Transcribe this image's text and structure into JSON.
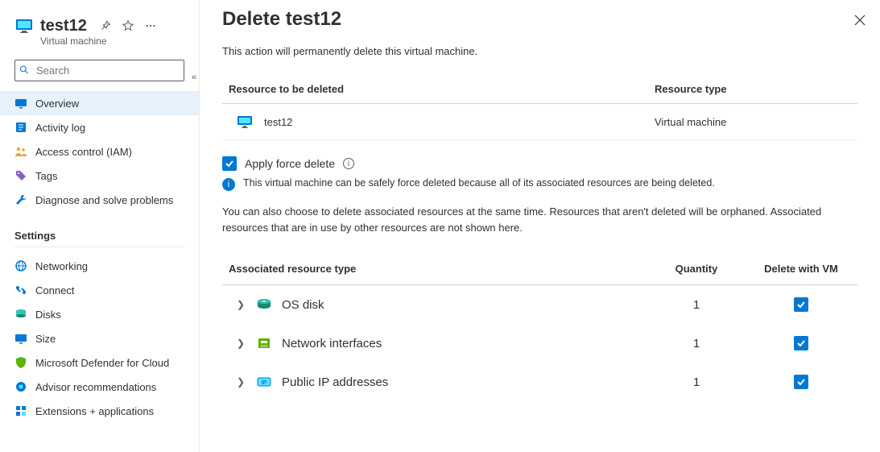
{
  "sidebar": {
    "title": "test12",
    "subtitle": "Virtual machine",
    "search_placeholder": "Search",
    "nav_main": [
      {
        "label": "Overview",
        "icon": "vm",
        "selected": true
      },
      {
        "label": "Activity log",
        "icon": "log",
        "selected": false
      },
      {
        "label": "Access control (IAM)",
        "icon": "people",
        "selected": false
      },
      {
        "label": "Tags",
        "icon": "tag",
        "selected": false
      },
      {
        "label": "Diagnose and solve problems",
        "icon": "wrench",
        "selected": false
      }
    ],
    "section_settings_label": "Settings",
    "nav_settings": [
      {
        "label": "Networking",
        "icon": "network"
      },
      {
        "label": "Connect",
        "icon": "connect"
      },
      {
        "label": "Disks",
        "icon": "disks"
      },
      {
        "label": "Size",
        "icon": "size"
      },
      {
        "label": "Microsoft Defender for Cloud",
        "icon": "shield"
      },
      {
        "label": "Advisor recommendations",
        "icon": "advisor"
      },
      {
        "label": "Extensions + applications",
        "icon": "ext"
      }
    ]
  },
  "panel": {
    "title": "Delete test12",
    "description": "This action will permanently delete this virtual machine.",
    "table": {
      "col_resource": "Resource to be deleted",
      "col_type": "Resource type",
      "rows": [
        {
          "name": "test12",
          "type": "Virtual machine"
        }
      ]
    },
    "force_delete_label": "Apply force delete",
    "force_delete_checked": true,
    "force_delete_info": "This virtual machine can be safely force deleted because all of its associated resources are being deleted.",
    "orphan_text": "You can also choose to delete associated resources at the same time. Resources that aren't deleted will be orphaned. Associated resources that are in use by other resources are not shown here.",
    "assoc": {
      "col_type": "Associated resource type",
      "col_qty": "Quantity",
      "col_del": "Delete with VM",
      "rows": [
        {
          "name": "OS disk",
          "qty": "1",
          "checked": true,
          "icon": "disk"
        },
        {
          "name": "Network interfaces",
          "qty": "1",
          "checked": true,
          "icon": "nic"
        },
        {
          "name": "Public IP addresses",
          "qty": "1",
          "checked": true,
          "icon": "ip"
        }
      ]
    }
  }
}
